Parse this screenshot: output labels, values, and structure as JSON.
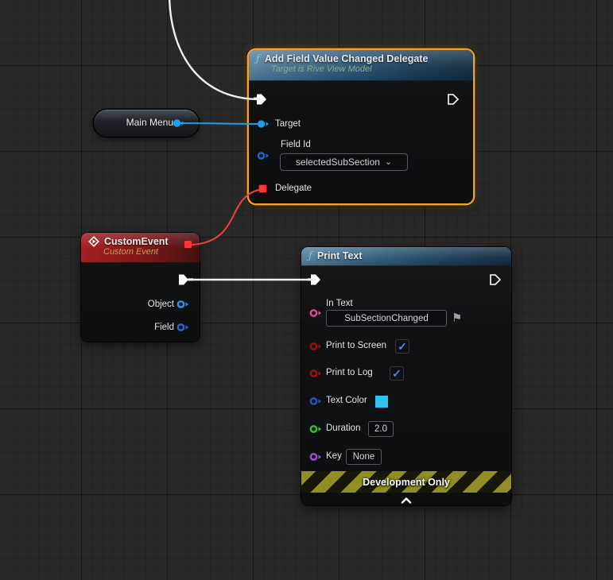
{
  "icons": {
    "function": "ƒ",
    "dropdown_chevron": "⌄",
    "flag": "⚑",
    "check": "✓"
  },
  "nodes": {
    "add_field_delegate": {
      "title": "Add Field Value Changed Delegate",
      "subtitle": "Target is Rive View Model",
      "target_label": "Target",
      "field_id_label": "Field Id",
      "field_id_value": "selectedSubSection",
      "delegate_label": "Delegate"
    },
    "main_menu": {
      "label": "Main Menu"
    },
    "custom_event": {
      "title": "CustomEvent",
      "subtitle": "Custom Event",
      "object_label": "Object",
      "field_label": "Field"
    },
    "print_text": {
      "title": "Print Text",
      "in_text_label": "In Text",
      "in_text_value": "SubSectionChanged",
      "print_to_screen_label": "Print to Screen",
      "print_to_screen_checked": "true",
      "print_to_log_label": "Print to Log",
      "print_to_log_checked": "true",
      "text_color_label": "Text Color",
      "text_color_value": "#29c6f0",
      "duration_label": "Duration",
      "duration_value": "2.0",
      "key_label": "Key",
      "key_value": "None",
      "banner": "Development Only"
    }
  },
  "colors": {
    "selection_border": "#efa028",
    "exec_pin": "#ffffff",
    "object_pin": "#18a0f0",
    "field_id_pin": "#1f6fd4",
    "delegate_pin": "#ff3333",
    "text_pin": "#dd4a96",
    "bool_pin": "#9c1212",
    "struct_pin": "#2a52cc",
    "float_pin": "#35c335",
    "name_pin": "#9b4fd6",
    "wire_exec": "#efefef",
    "wire_object": "#1e9ce8",
    "wire_delegate": "#e8424a"
  }
}
